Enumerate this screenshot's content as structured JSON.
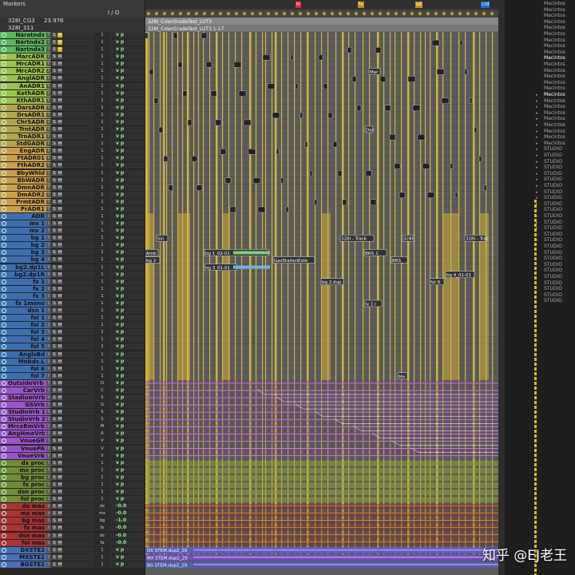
{
  "header": {
    "markers_label": "Markers",
    "io_label": "I / O",
    "top_row": {
      "session": "328I_CG3",
      "framerate": "23.976"
    },
    "second_row": {
      "name": "328I_311"
    },
    "markers": [
      {
        "label": "H",
        "color": "#e23"
      },
      {
        "label": "fx",
        "color": "#c38c1a"
      },
      {
        "label": "sd",
        "color": "#c38c1a"
      },
      {
        "label": "crd",
        "color": "#1e6ad6"
      }
    ],
    "clip_rows": [
      "328I_ColorGradeTest_LUT3",
      "328I_ColorGradeTest_LUT3.1-17"
    ],
    "col_headers": [
      "32",
      "19",
      "Del"
    ]
  },
  "tracks": [
    {
      "name": "Naratndx",
      "color": "#5cb85c",
      "io": "1",
      "vp": "v p"
    },
    {
      "name": "Nartndx2",
      "color": "#5cb85c",
      "io": "1",
      "vp": "v p"
    },
    {
      "name": "Nartndx3",
      "color": "#5cb85c",
      "io": "1",
      "vp": "v p"
    },
    {
      "name": "MarcADR",
      "color": "#9dc24b",
      "io": "1",
      "vp": "v p"
    },
    {
      "name": "MrcADR1",
      "color": "#9dc24b",
      "io": "1",
      "vp": "v p"
    },
    {
      "name": "MrcADR2",
      "color": "#9dc24b",
      "io": "1",
      "vp": "v p"
    },
    {
      "name": "AnglADR",
      "color": "#9dc24b",
      "io": "1",
      "vp": "v p"
    },
    {
      "name": "AnADR1",
      "color": "#9dc24b",
      "io": "1",
      "vp": "v p"
    },
    {
      "name": "KethADR",
      "color": "#9dc24b",
      "io": "1",
      "vp": "v p"
    },
    {
      "name": "KthADR1",
      "color": "#9dc24b",
      "io": "1",
      "vp": "v p"
    },
    {
      "name": "DarsADR",
      "color": "#b4a54f",
      "io": "1",
      "vp": "v p"
    },
    {
      "name": "DrsADR1",
      "color": "#b4a54f",
      "io": "1",
      "vp": "v p"
    },
    {
      "name": "ChrSADR",
      "color": "#b4a54f",
      "io": "1",
      "vp": "v p"
    },
    {
      "name": "TrntADR",
      "color": "#b4a54f",
      "io": "1",
      "vp": "v p"
    },
    {
      "name": "TrnADR1",
      "color": "#b4a54f",
      "io": "1",
      "vp": "v p"
    },
    {
      "name": "StdGADR",
      "color": "#b4a54f",
      "io": "1",
      "vp": "v p"
    },
    {
      "name": "EngADR",
      "color": "#c9a04a",
      "io": "1",
      "vp": "v p"
    },
    {
      "name": "FtADR01",
      "color": "#c9a04a",
      "io": "1",
      "vp": "v p"
    },
    {
      "name": "FthADR2",
      "color": "#c9a04a",
      "io": "1",
      "vp": "v p"
    },
    {
      "name": "BbyWhld",
      "color": "#c9a04a",
      "io": "1",
      "vp": "v p"
    },
    {
      "name": "BbWADR",
      "color": "#c9a04a",
      "io": "1",
      "vp": "v p"
    },
    {
      "name": "DmnADR",
      "color": "#c9a04a",
      "io": "1",
      "vp": "v p"
    },
    {
      "name": "DmADR2",
      "color": "#c9a04a",
      "io": "1",
      "vp": "v p"
    },
    {
      "name": "PrmtADR",
      "color": "#c9a04a",
      "io": "1",
      "vp": "v p"
    },
    {
      "name": "PrADR1",
      "color": "#c9a04a",
      "io": "1",
      "vp": "v p"
    },
    {
      "name": "ADR",
      "color": "#3d6fb0",
      "io": "1",
      "vp": "v p"
    },
    {
      "name": "mx 1",
      "color": "#3d6fb0",
      "io": "1",
      "vp": "v p"
    },
    {
      "name": "mx 2",
      "color": "#3d6fb0",
      "io": "1",
      "vp": "v p"
    },
    {
      "name": "bg 1",
      "color": "#3d6fb0",
      "io": "1",
      "vp": "v p"
    },
    {
      "name": "bg 2",
      "color": "#3d6fb0",
      "io": "1",
      "vp": "v p"
    },
    {
      "name": "bg 3",
      "color": "#3d6fb0",
      "io": "1",
      "vp": "v p"
    },
    {
      "name": "bg 4",
      "color": "#3d6fb0",
      "io": "1",
      "vp": "v p"
    },
    {
      "name": "bg2.dp1L",
      "color": "#3d6fb0",
      "io": "1",
      "vp": "v p"
    },
    {
      "name": "bg2.dp1R",
      "color": "#3d6fb0",
      "io": "1",
      "vp": "v p"
    },
    {
      "name": "fx 1",
      "color": "#3d6fb0",
      "io": "1",
      "vp": "v p"
    },
    {
      "name": "fx 2",
      "color": "#3d6fb0",
      "io": "1",
      "vp": "v p"
    },
    {
      "name": "fx 3",
      "color": "#3d6fb0",
      "io": "1",
      "vp": "v p"
    },
    {
      "name": "fx 1mono",
      "color": "#3d6fb0",
      "io": "1",
      "vp": "v p"
    },
    {
      "name": "dsn 1",
      "color": "#3d6fb0",
      "io": "1",
      "vp": "v p"
    },
    {
      "name": "fol 1",
      "color": "#3d6fb0",
      "io": "1",
      "vp": "v p"
    },
    {
      "name": "fol 2",
      "color": "#3d6fb0",
      "io": "1",
      "vp": "v p"
    },
    {
      "name": "fol 3",
      "color": "#3d6fb0",
      "io": "1",
      "vp": "v p"
    },
    {
      "name": "fol 4",
      "color": "#3d6fb0",
      "io": "1",
      "vp": "v p"
    },
    {
      "name": "fol 5",
      "color": "#3d6fb0",
      "io": "1",
      "vp": "v p"
    },
    {
      "name": "AnglsBd",
      "color": "#3d6fb0",
      "io": "1",
      "vp": "v p"
    },
    {
      "name": "Mnbds.L",
      "color": "#3d6fb0",
      "io": "1",
      "vp": "v p"
    },
    {
      "name": "fol 6",
      "color": "#3d6fb0",
      "io": "1",
      "vp": "v p"
    },
    {
      "name": "fol 7",
      "color": "#3d6fb0",
      "io": "1",
      "vp": "v p"
    },
    {
      "name": "OutsideVrb 1",
      "color": "#9a55c9",
      "io": "O",
      "vp": "v p"
    },
    {
      "name": "CarVrb",
      "color": "#9a55c9",
      "io": "C",
      "vp": "v p"
    },
    {
      "name": "StadiumVrb",
      "color": "#9a55c9",
      "io": "S",
      "vp": "v p"
    },
    {
      "name": "GSVrb",
      "color": "#9a55c9",
      "io": "G",
      "vp": "v p"
    },
    {
      "name": "StudioVrb 1",
      "color": "#9a55c9",
      "io": "S",
      "vp": "v p"
    },
    {
      "name": "StudioVrb 2",
      "color": "#9a55c9",
      "io": "S",
      "vp": "v p"
    },
    {
      "name": "MrcoRmVrb",
      "color": "#9a55c9",
      "io": "M",
      "vp": "v p"
    },
    {
      "name": "AngHmeVrb",
      "color": "#9a55c9",
      "io": "A",
      "vp": "v p"
    },
    {
      "name": "VnueGR",
      "color": "#9a55c9",
      "io": "V",
      "vp": "v p"
    },
    {
      "name": "VnuePA",
      "color": "#9a55c9",
      "io": "V",
      "vp": "v p"
    },
    {
      "name": "VnueVrb",
      "color": "#9a55c9",
      "io": "V",
      "vp": "v p"
    },
    {
      "name": "dx proc",
      "color": "#6f8d36",
      "io": "1",
      "vp": "v p"
    },
    {
      "name": "mx proc",
      "color": "#6f8d36",
      "io": "1",
      "vp": "v p"
    },
    {
      "name": "bg proc",
      "color": "#6f8d36",
      "io": "1",
      "vp": "v p"
    },
    {
      "name": "fx proc",
      "color": "#6f8d36",
      "io": "1",
      "vp": "v p"
    },
    {
      "name": "dsn proc",
      "color": "#6f8d36",
      "io": "1",
      "vp": "v p"
    },
    {
      "name": "fol proc",
      "color": "#6f8d36",
      "io": "1",
      "vp": "v p"
    },
    {
      "name": "dx mas",
      "color": "#a33",
      "io": "dx",
      "vp": "-0.0"
    },
    {
      "name": "mx mas",
      "color": "#a33",
      "io": "mx",
      "vp": "-0.0"
    },
    {
      "name": "bg mas",
      "color": "#a33",
      "io": "bg",
      "vp": "-1.0"
    },
    {
      "name": "fx mas",
      "color": "#a33",
      "io": "fx",
      "vp": "-0.0"
    },
    {
      "name": "dsn mas",
      "color": "#a33",
      "io": "ds",
      "vp": "-0.0"
    },
    {
      "name": "fol mas",
      "color": "#a33",
      "io": "fo",
      "vp": "-0.0"
    },
    {
      "name": "DXSTE2",
      "color": "#4a6fb5",
      "io": "1",
      "vp": "v p"
    },
    {
      "name": "MXSTE2",
      "color": "#4a6fb5",
      "io": "1",
      "vp": "v p"
    },
    {
      "name": "BGSTE2",
      "color": "#4a6fb5",
      "io": "1",
      "vp": "v p"
    }
  ],
  "clips": [
    {
      "label": "Mar"
    },
    {
      "label": "Dar"
    },
    {
      "label": "Sin"
    },
    {
      "label": "328I - Track"
    },
    {
      "label": "328I"
    },
    {
      "label": "328I - Trac"
    },
    {
      "label": "Amb"
    },
    {
      "label": "bg 1_02-01"
    },
    {
      "label": "bg 2"
    },
    {
      "label": "GasStationExte"
    },
    {
      "label": "BRS_C"
    },
    {
      "label": "BRS_"
    },
    {
      "label": "bg 3_01-01"
    },
    {
      "label": "bg 2.dup"
    },
    {
      "label": "bg 4_01-01"
    },
    {
      "label": "fol 6"
    },
    {
      "label": "fx 1 r"
    },
    {
      "label": "Me"
    },
    {
      "label": "DX STEM.dup2_29"
    },
    {
      "label": "MX STEM.dup2_29"
    },
    {
      "label": "BG STEM.dup2_29"
    }
  ],
  "right_panel": {
    "items": [
      "Macintos",
      "Macintos",
      "Macintos",
      "Macintos",
      "Macintos",
      "Macintos",
      "Macintos",
      "Macintos",
      "Macintos",
      "Macintos",
      "Macintos",
      "Macintos",
      "Macintos",
      "Macintos",
      "Macintos",
      "Macintos",
      "Macintos",
      "Macintos",
      "Macintos",
      "Macintos",
      "Macintos",
      "Macintos",
      "Macintos",
      "Macintos",
      "STUDIO",
      "STUDIO",
      "STUDIO",
      "STUDIO",
      "STUDIO",
      "STUDIO",
      "STUDIO",
      "STUDIO",
      "STUDIO",
      "STUDIO",
      "STUDIO",
      "STUDIO",
      "STUDIO",
      "STUDIO",
      "STUDIO",
      "STUDIO",
      "STUDIO",
      "STUDIO",
      "STUDIO",
      "STUDIO",
      "STUDIO",
      "STUDIO",
      "STUDIO",
      "STUDIO",
      "STUDIO",
      "STUDIO"
    ]
  },
  "watermark": "知乎 @EJ老王",
  "colors": {
    "timeline_bg": "#5b5b5b",
    "yellow_clip": "#e8c63a",
    "purple_clip": "#b25ed6",
    "green_clip": "#8fb03a",
    "blue_clip": "#4d78c8"
  }
}
